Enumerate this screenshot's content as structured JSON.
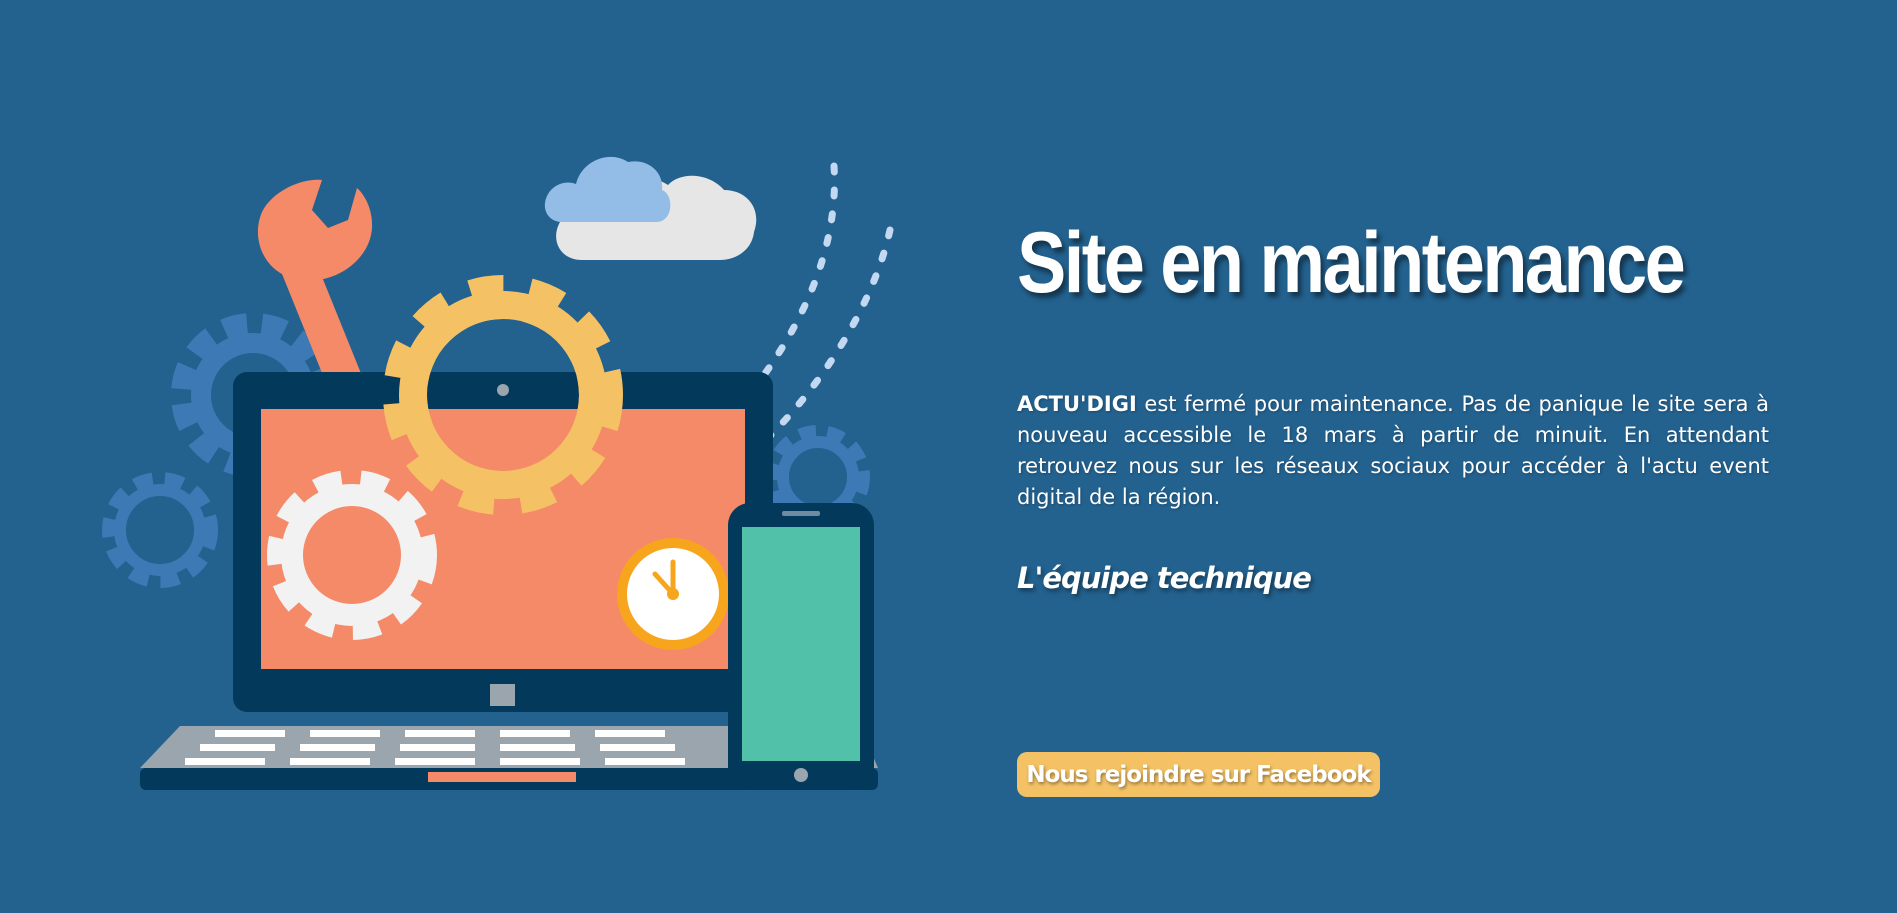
{
  "maintenance": {
    "title": "Site en maintenance",
    "brand": "ACTU'DIGI",
    "message": " est fermé pour maintenance. Pas de panique le site sera à nouveau accessible le 18 mars à partir de minuit. En attendant retrouvez nous sur les réseaux sociaux pour accéder à l'actu event digital de la région.",
    "signature": "L'équipe technique",
    "facebook_button": "Nous rejoindre sur Facebook"
  },
  "colors": {
    "background": "#23618e",
    "screen": "#f48a68",
    "gear_yellow": "#f4c265",
    "phone_screen": "#52c1a9",
    "button": "#f4c265"
  },
  "illustration": {
    "icons": [
      "wrench-icon",
      "gear-icon",
      "cloud-icon",
      "clock-icon",
      "laptop-icon",
      "smartphone-icon"
    ]
  }
}
